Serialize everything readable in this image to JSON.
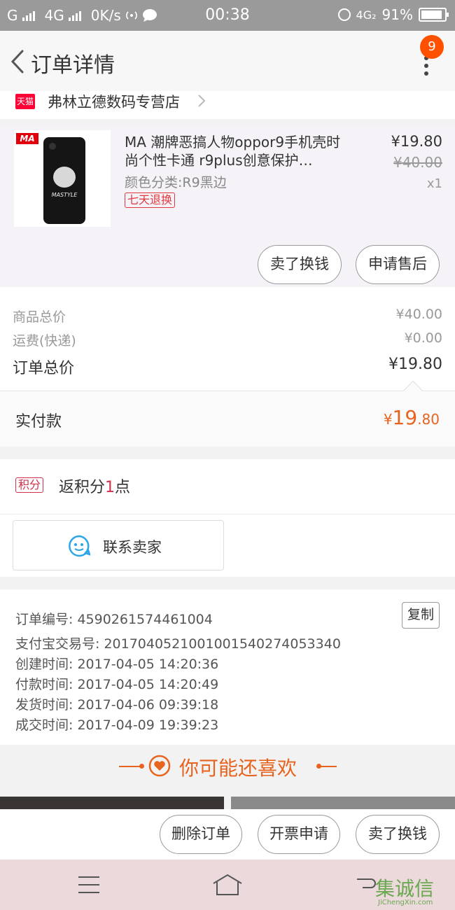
{
  "status_bar": {
    "carrier1": "G",
    "network": "4G",
    "speed": "0K/s",
    "time": "00:38",
    "network2": "4G₂",
    "battery": "91%",
    "battery_level": 0.91
  },
  "nav": {
    "title": "订单详情",
    "badge": "9"
  },
  "store": {
    "badge": "天猫",
    "name": "弗林立德数码专营店"
  },
  "product": {
    "brand_logo": "MA",
    "image_text": "MASTYLE",
    "title": "MA 潮牌恶搞人物oppor9手机壳时尚个性卡通 r9plus创意保护…",
    "sku": "颜色分类:R9黑边",
    "refund_tag": "七天退换",
    "price": "¥19.80",
    "original_price": "¥40.00",
    "quantity": "x1",
    "sell_button": "卖了换钱",
    "after_sale_button": "申请售后"
  },
  "summary": {
    "goods_total_label": "商品总价",
    "goods_total": "¥40.00",
    "shipping_label": "运费(快递)",
    "shipping": "¥0.00",
    "order_total_label": "订单总价",
    "order_total": "¥19.80",
    "paid_label": "实付款",
    "paid_currency": "¥",
    "paid_integer": "19",
    "paid_decimal": ".80"
  },
  "points": {
    "tag": "积分",
    "prefix": "返积分",
    "value": "1",
    "suffix": "点"
  },
  "contact": {
    "label": "联系卖家"
  },
  "order_info": {
    "copy_button": "复制",
    "lines": [
      "订单编号: 4590261574461004",
      "支付宝交易号: 2017040521001001540274053340",
      "创建时间: 2017-04-05 14:20:36",
      "付款时间: 2017-04-05 14:20:49",
      "发货时间: 2017-04-06 09:39:18",
      "成交时间: 2017-04-09 19:39:23"
    ]
  },
  "recommend": {
    "title": "你可能还喜欢"
  },
  "bottom_actions": {
    "delete": "删除订单",
    "invoice": "开票申请",
    "sell": "卖了换钱"
  },
  "watermark": {
    "text": "集诚信",
    "sub": "JiChengXin.com"
  }
}
